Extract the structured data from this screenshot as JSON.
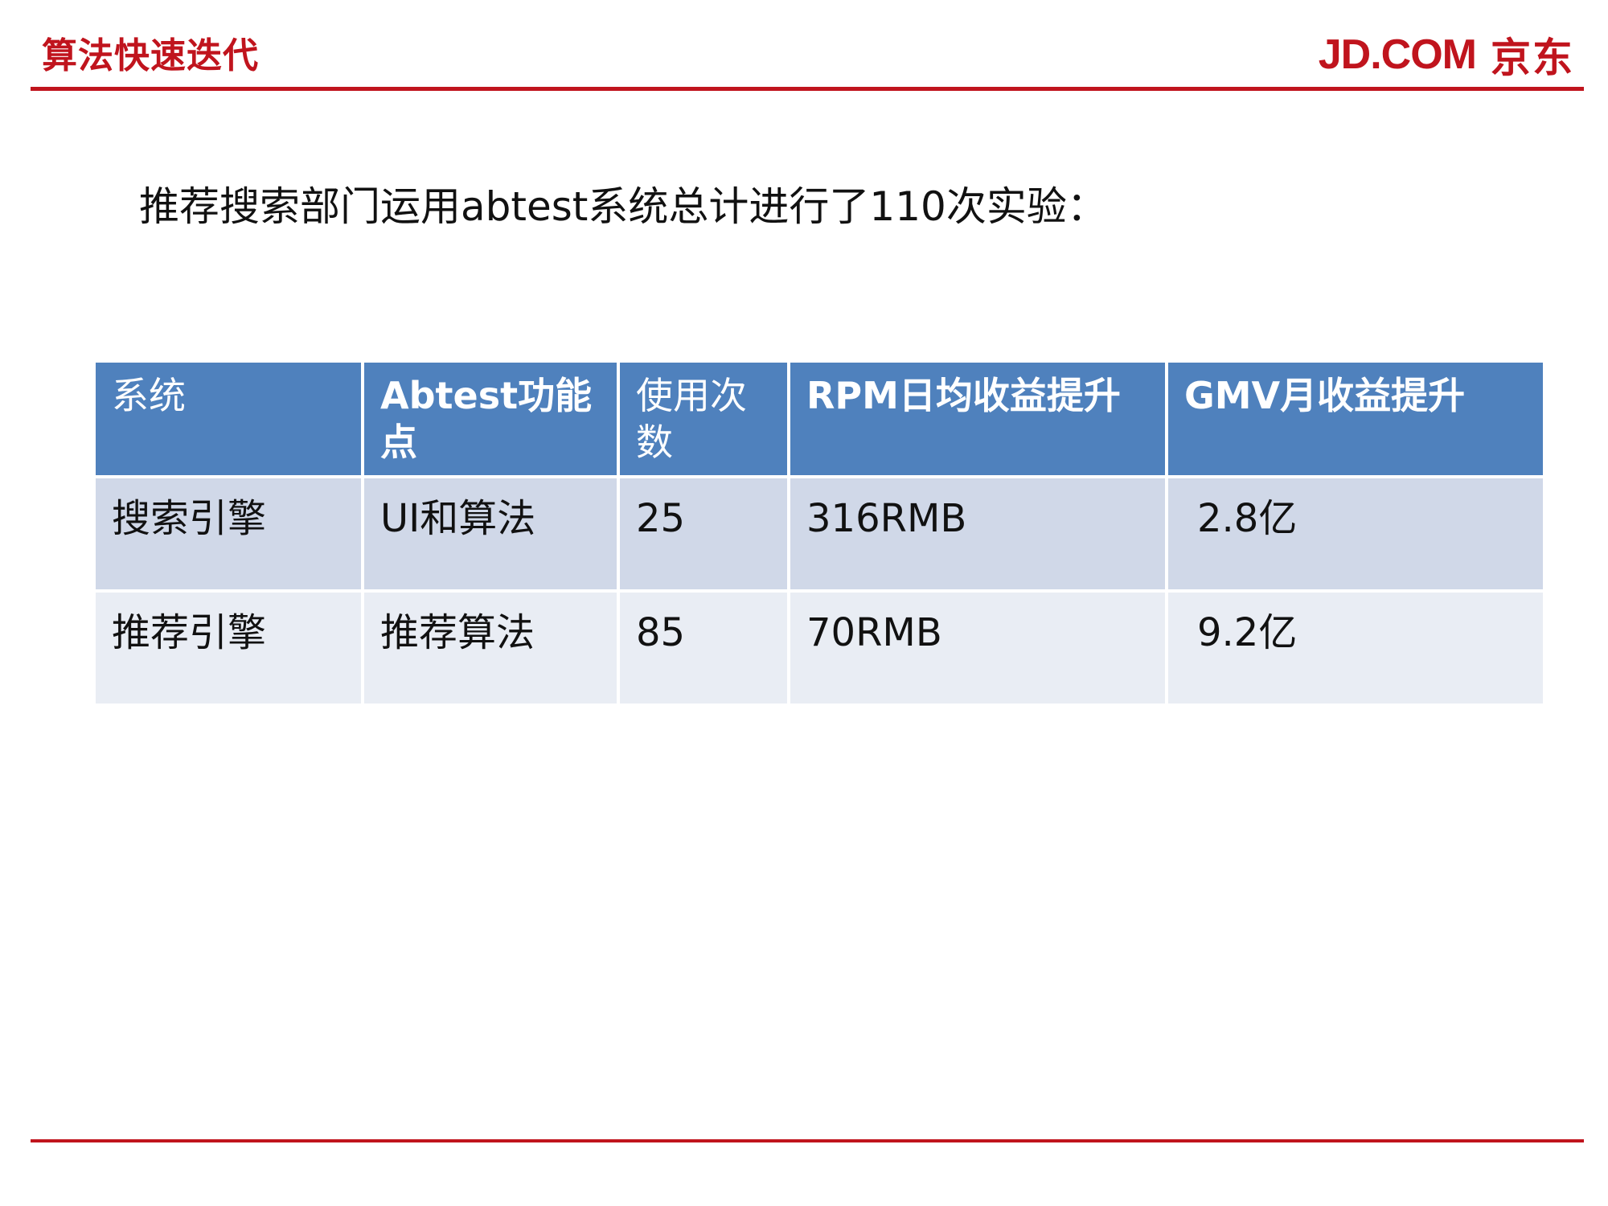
{
  "header": {
    "title": "算法快速迭代",
    "brand_latin": "JD.COM",
    "brand_cn": "京东",
    "accent_color": "#c0141d"
  },
  "intro": "推荐搜索部门运用abtest系统总计进行了110次实验：",
  "table": {
    "header_color": "#4f81bd",
    "headers": [
      "系统",
      "Abtest功能点",
      "使用次数",
      "RPM日均收益提升",
      "GMV月收益提升"
    ],
    "rows": [
      [
        "搜索引擎",
        "UI和算法",
        "25",
        "316RMB",
        "2.8亿"
      ],
      [
        "推荐引擎",
        "推荐算法",
        "85",
        "70RMB",
        "9.2亿"
      ]
    ]
  }
}
